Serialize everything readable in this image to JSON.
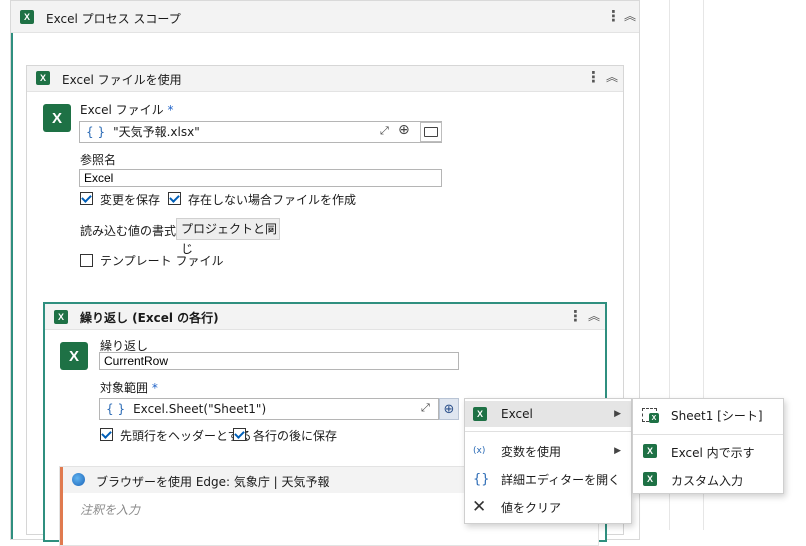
{
  "outer": {
    "title": "Excel プロセス スコープ"
  },
  "use_excel": {
    "title": "Excel ファイルを使用",
    "file_label": "Excel ファイル",
    "required_mark": "*",
    "file_value": "\"天気予報.xlsx\"",
    "ref_label": "参照名",
    "ref_value": "Excel",
    "save_changes": "変更を保存",
    "create_if_missing": "存在しない場合ファイルを作成",
    "read_format_label": "読み込む値の書式",
    "read_format_value": "プロジェクトと同じ",
    "template_label": "テンプレート ファイル"
  },
  "loop": {
    "title": "繰り返し (Excel の各行)",
    "each_label": "繰り返し",
    "each_value": "CurrentRow",
    "range_label": "対象範囲",
    "required_mark": "*",
    "range_value": "Excel.Sheet(\"Sheet1\")",
    "header_row": "先頭行をヘッダーとする",
    "save_after": "各行の後に保存"
  },
  "browser": {
    "title": "ブラウザーを使用 Edge: 気象庁 | 天気予報",
    "annotation_placeholder": "注釈を入力"
  },
  "context_menu": {
    "items": [
      {
        "label": "Excel"
      },
      {
        "label": "変数を使用"
      },
      {
        "label": "詳細エディターを開く"
      },
      {
        "label": "値をクリア"
      }
    ]
  },
  "submenu": {
    "items": [
      {
        "label": "Sheet1 [シート]"
      },
      {
        "label": "Excel 内で示す"
      },
      {
        "label": "カスタム入力"
      }
    ]
  },
  "icons": {
    "excel": "excel-icon",
    "kebab": "more-vertical-icon",
    "collapse": "chevron-double-up-icon",
    "expression": "curly-braces-icon",
    "expand": "expand-icon",
    "plus": "plus-circle-icon",
    "folder": "folder-icon"
  },
  "colors": {
    "excel_green": "#1e7145",
    "loop_border": "#2f8f7f",
    "browser_accent": "#e07a4f",
    "check_blue": "#005fb8"
  }
}
